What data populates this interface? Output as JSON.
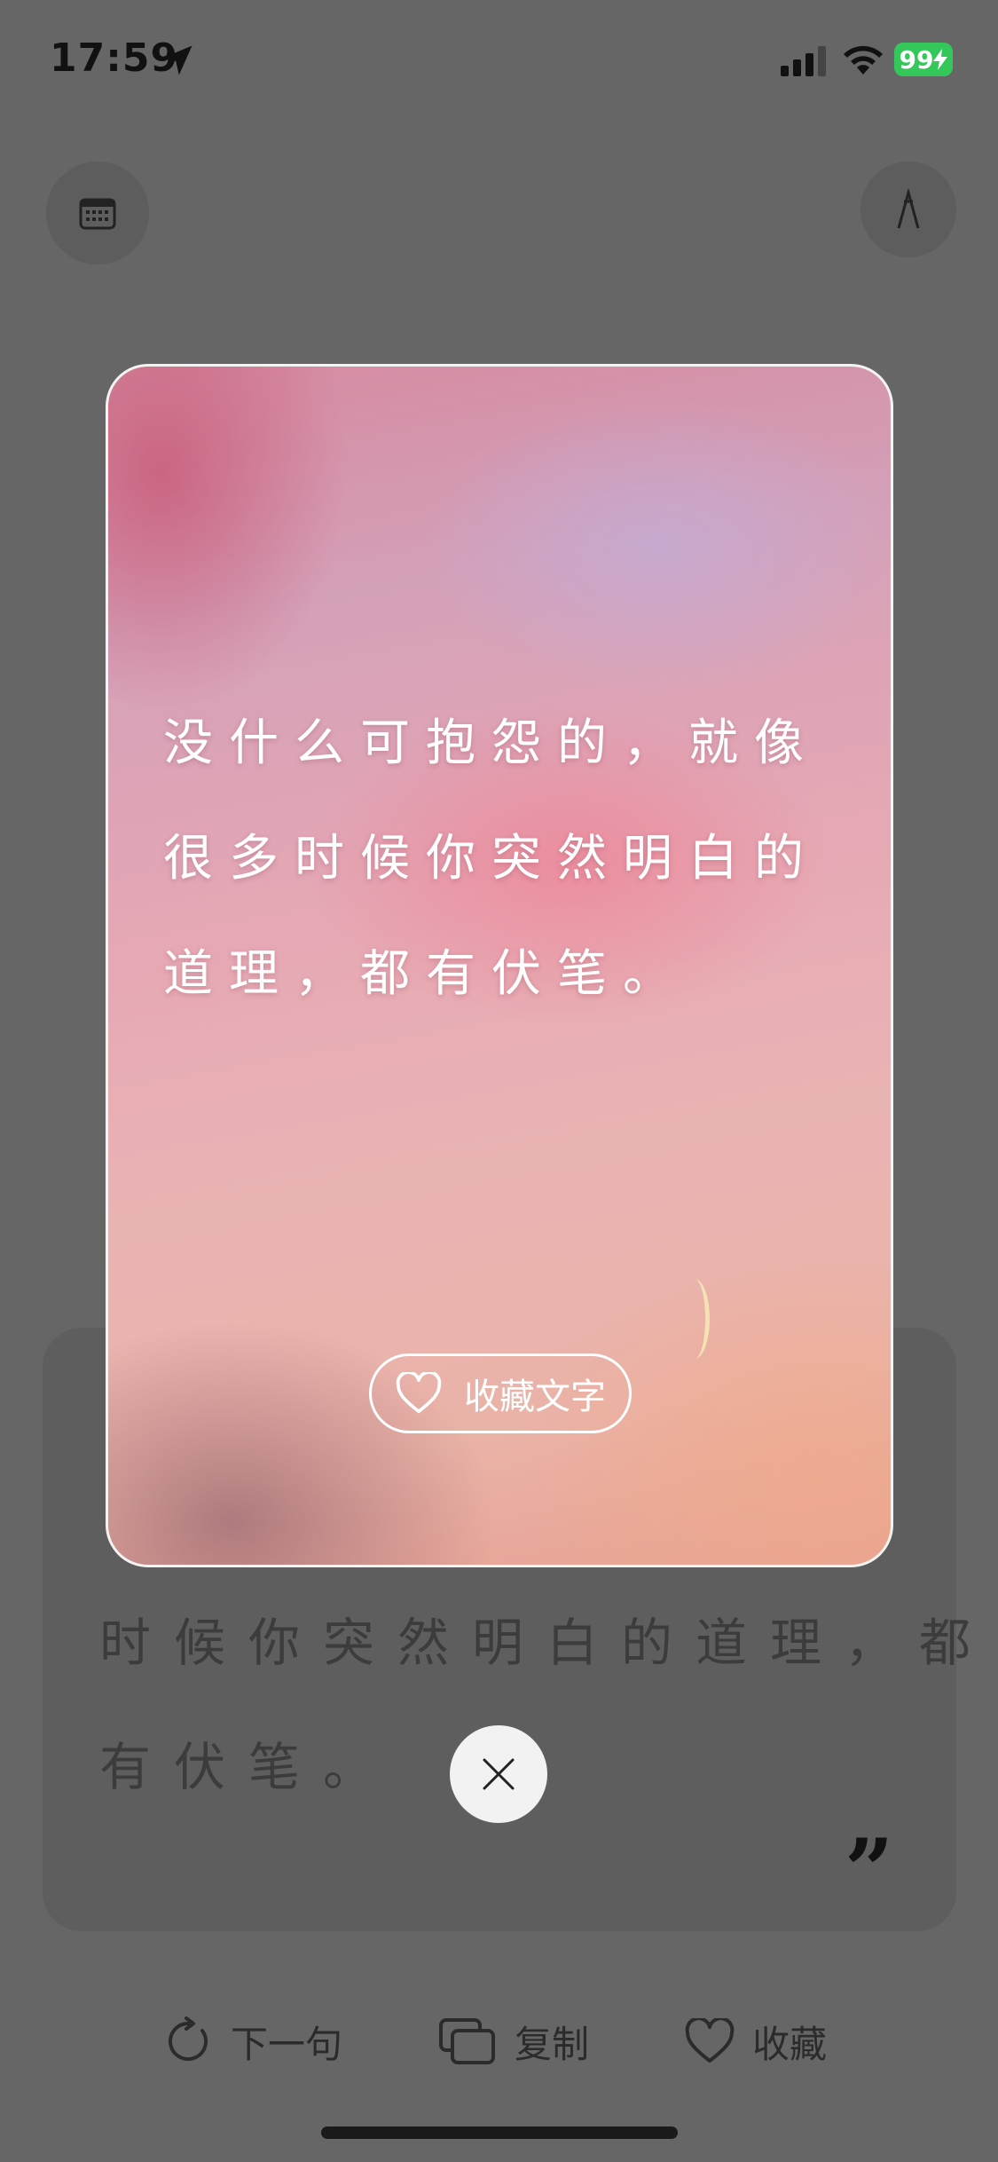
{
  "status_bar": {
    "time": "17:59",
    "battery": "99"
  },
  "icons": {
    "calendar": "calendar-icon",
    "font": "font-style-icon",
    "location": "location-arrow-icon",
    "signal": "cellular-signal-icon",
    "wifi": "wifi-icon",
    "heart": "heart-icon",
    "refresh": "refresh-icon",
    "copy": "copy-icon",
    "close": "close-icon",
    "quote_mark": "closing-quote-icon"
  },
  "modal": {
    "quote_lines": [
      "没什么可抱怨的，就像",
      "很多时候你突然明白的",
      "道理，都有伏笔。"
    ],
    "favorite_text_button": "收藏文字"
  },
  "background_card": {
    "line1": "时候你突然明白的道理，都",
    "line2": "有伏笔。",
    "quote_mark": "”"
  },
  "actions": {
    "next": "下一句",
    "copy": "复制",
    "favorite": "收藏"
  },
  "colors": {
    "overlay": "#666666",
    "battery": "#34c759",
    "text_white": "#ffffff"
  }
}
